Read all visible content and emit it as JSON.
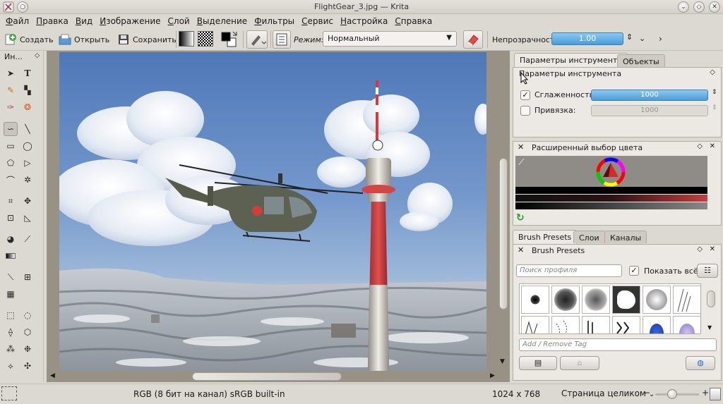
{
  "window": {
    "title": "FlightGear_3.jpg — Krita"
  },
  "menu": [
    "Файл",
    "Правка",
    "Вид",
    "Изображение",
    "Слой",
    "Выделение",
    "Фильтры",
    "Сервис",
    "Настройка",
    "Справка"
  ],
  "toolbar": {
    "new_label": "Создать",
    "open_label": "Открыть",
    "save_label": "Сохранить",
    "mode_label": "Режим:",
    "mode_value": "Нормальный",
    "opacity_label": "Непрозрачность:",
    "opacity_value": "1.00"
  },
  "toolbox": {
    "header": "Ин..."
  },
  "dock": {
    "tabs_top": [
      "Параметры инструмента",
      "Объекты"
    ],
    "tool_options": {
      "header": "Параметры инструмента",
      "smoothing_label": "Сглаженность:",
      "smoothing_value": "1000",
      "snap_label": "Привязка:",
      "snap_value": "1000"
    },
    "color_selector": {
      "header": "Расширенный выбор цвета"
    },
    "tabs_bottom": [
      "Brush Presets",
      "Слои",
      "Каналы"
    ],
    "brush_presets": {
      "header": "Brush Presets",
      "search_placeholder": "Поиск профиля",
      "show_all_label": "Показать всё",
      "tag_placeholder": "Add / Remove Tag"
    }
  },
  "status": {
    "color_model": "RGB (8 бит на канал)  sRGB built-in",
    "image_size": "1024 x 768",
    "zoom_mode": "Страница целиком"
  },
  "colors": {
    "accent_blue": "#4a9cd8",
    "window_bg": "#dcd8d2",
    "canvas_surround": "#979186"
  }
}
